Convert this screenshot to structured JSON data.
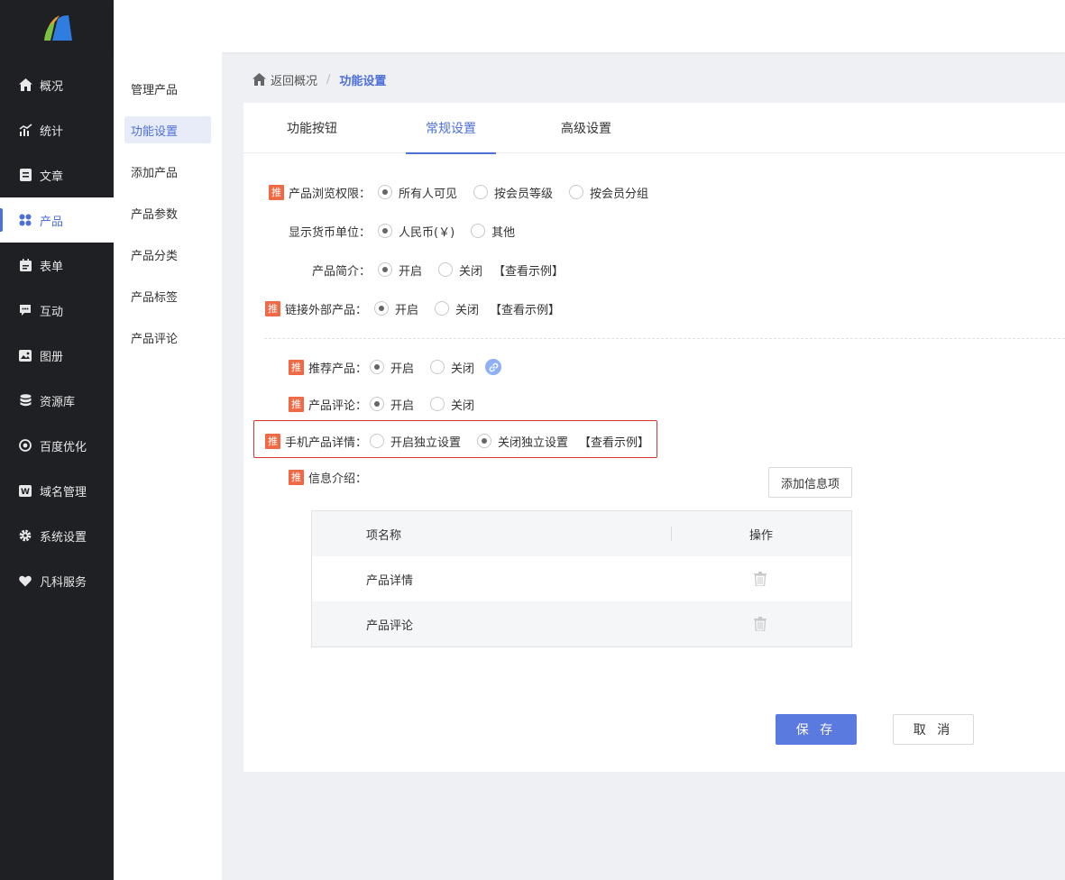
{
  "sidebar": {
    "logo_icon": "brand-logo-icon",
    "items": [
      {
        "label": "概况",
        "icon": "home-icon"
      },
      {
        "label": "统计",
        "icon": "chart-icon"
      },
      {
        "label": "文章",
        "icon": "article-icon"
      },
      {
        "label": "产品",
        "icon": "product-icon",
        "active": true
      },
      {
        "label": "表单",
        "icon": "form-icon"
      },
      {
        "label": "互动",
        "icon": "chat-icon"
      },
      {
        "label": "图册",
        "icon": "album-icon"
      },
      {
        "label": "资源库",
        "icon": "database-icon"
      },
      {
        "label": "百度优化",
        "icon": "seo-icon"
      },
      {
        "label": "域名管理",
        "icon": "domain-icon"
      },
      {
        "label": "系统设置",
        "icon": "gear-icon"
      },
      {
        "label": "凡科服务",
        "icon": "heart-icon"
      }
    ]
  },
  "submenu": {
    "items": [
      {
        "label": "管理产品"
      },
      {
        "label": "功能设置",
        "active": true
      },
      {
        "label": "添加产品"
      },
      {
        "label": "产品参数"
      },
      {
        "label": "产品分类"
      },
      {
        "label": "产品标签"
      },
      {
        "label": "产品评论"
      }
    ]
  },
  "breadcrumb": {
    "back": "返回概况",
    "sep": "/",
    "current": "功能设置"
  },
  "tabs": [
    {
      "label": "功能按钮"
    },
    {
      "label": "常规设置",
      "active": true
    },
    {
      "label": "高级设置"
    }
  ],
  "badge_text": "推",
  "settings": {
    "browse": {
      "label": "产品浏览权限：",
      "opt1": "所有人可见",
      "opt2": "按会员等级",
      "opt3": "按会员分组"
    },
    "currency": {
      "label": "显示货币单位：",
      "opt1": "人民币(￥)",
      "opt2": "其他"
    },
    "intro": {
      "label": "产品简介：",
      "opt1": "开启",
      "opt2": "关闭",
      "link": "【查看示例】"
    },
    "external": {
      "label": "链接外部产品：",
      "opt1": "开启",
      "opt2": "关闭",
      "link": "【查看示例】"
    },
    "recommend": {
      "label": "推荐产品：",
      "opt1": "开启",
      "opt2": "关闭"
    },
    "review": {
      "label": "产品评论：",
      "opt1": "开启",
      "opt2": "关闭"
    },
    "mobile": {
      "label": "手机产品详情：",
      "opt1": "开启独立设置",
      "opt2": "关闭独立设置",
      "link": "【查看示例】"
    },
    "info": {
      "label": "信息介绍："
    }
  },
  "add_info_button": "添加信息项",
  "table": {
    "headers": {
      "name": "项名称",
      "op": "操作"
    },
    "rows": [
      {
        "name": "产品详情"
      },
      {
        "name": "产品评论"
      }
    ]
  },
  "buttons": {
    "save": "保 存",
    "cancel": "取 消"
  },
  "colors": {
    "accent": "#4d6fd8",
    "badge": "#ef6a44",
    "highlight_border": "#d8322c",
    "sidebar_bg": "#1f2024"
  }
}
